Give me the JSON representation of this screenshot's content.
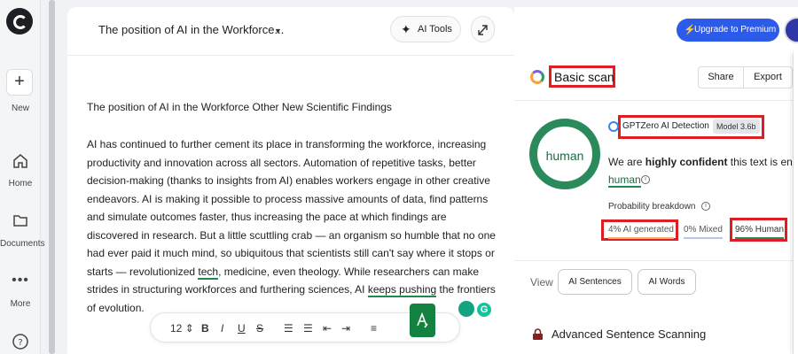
{
  "sidebar": {
    "logo": "gptzero-logo-icon",
    "items": [
      {
        "label": "New",
        "icon": "plus-icon"
      },
      {
        "label": "Home",
        "icon": "home-icon"
      },
      {
        "label": "Documents",
        "icon": "folder-icon"
      },
      {
        "label": "More",
        "icon": "more-dots-icon"
      }
    ],
    "help_icon": "help-icon"
  },
  "editor": {
    "doc_title": "The position of AI in the Workforce...",
    "ai_tools_label": "AI Tools",
    "heading": "The position of AI in the Workforce Other New Scientific Findings",
    "body_part1": "AI has continued to further cement its place in transforming the workforce, increasing productivity and innovation across all sectors. Automation of repetitive tasks, better decision-making (thanks to insights from AI) enables workers engage in other creative endeavors. AI is making it possible to process massive amounts of data, find patterns and simulate outcomes faster, thus increasing the pace at which findings are discovered in research. But a little scuttling crab — an organism so humble that no one had ever paid it much mind, so ubiquitous that scientists still can't say where it stops or starts — revolutionized ",
    "body_link1": "tech",
    "body_part2": ", medicine, even theology. While researchers can make strides in structuring workforces and furthering sciences, AI ",
    "body_link2": "keeps pushing",
    "body_part3": " the frontiers of evolution.",
    "format_bar": {
      "font_size": "12",
      "bold": "B",
      "italic": "I",
      "underline": "U",
      "strike": "S"
    },
    "grammarly_badge": "G"
  },
  "header": {
    "premium_label": "Upgrade to Premium"
  },
  "scan": {
    "title": "Basic scan",
    "share_label": "Share",
    "export_label": "Export",
    "result_label": "human",
    "detector_name": "GPTZero AI Detection",
    "model_badge": "Model 3.6b",
    "confidence_prefix": "We are ",
    "confidence_strong": "highly confident",
    "confidence_suffix": " this text is entire",
    "result_word": "human",
    "prob_breakdown_label": "Probability breakdown",
    "ai_generated": "4% AI generated",
    "mixed": "0% Mixed",
    "human": "96% Human",
    "view_label": "View",
    "view_tabs": [
      "AI Sentences",
      "AI Words"
    ],
    "advanced_label": "Advanced Sentence Scanning"
  },
  "colors": {
    "accent_blue": "#2b5be8",
    "human_green": "#2b8a5b",
    "highlight_red": "#dd1e24",
    "ai_orange": "#f5b06a"
  }
}
